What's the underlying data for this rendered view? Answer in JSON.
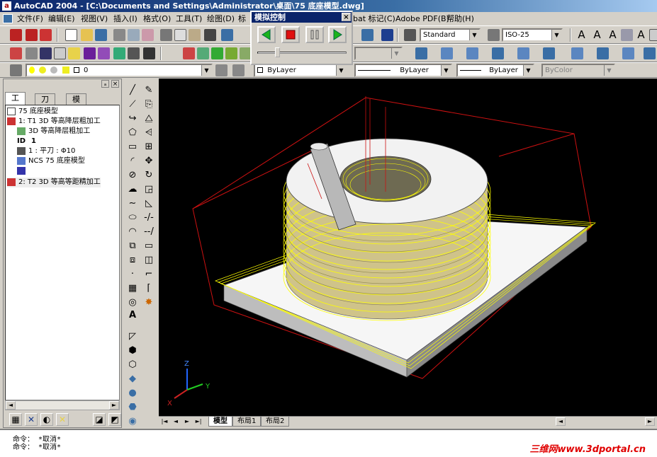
{
  "window": {
    "title": "AutoCAD 2004 - [C:\\Documents and Settings\\Administrator\\桌面\\75 底座模型.dwg]"
  },
  "menu": [
    "文件(F)",
    "编辑(E)",
    "视图(V)",
    "插入(I)",
    "格式(O)",
    "工具(T)",
    "绘图(D)",
    "标",
    "bat 标记(C)",
    "Adobe PDF(B)",
    "帮助(H)"
  ],
  "toolbar": {
    "text_style": "Standard",
    "dim_style": "ISO-25",
    "layer": "0",
    "color": "ByLayer",
    "linetype": "ByLayer",
    "lineweight": "ByLayer",
    "plotstyle": "ByColor"
  },
  "sim_panel": {
    "title": "模拟控制",
    "close": "×",
    "slider_position": 0.2
  },
  "left_panel": {
    "tabs": [
      "工单",
      "刀具",
      "模型"
    ],
    "active_tab": 0,
    "tree": [
      "75 底座模型",
      "1: T1 3D 等高降层粗加工",
      "3D 等高降层粗加工",
      "1",
      "1 :  平刀 : Φ10",
      "NCS 75 底座模型",
      "",
      "2: T2 3D 等高等距精加工"
    ]
  },
  "layout_tabs": [
    "模型",
    "布局1",
    "布局2"
  ],
  "command": {
    "line1": "命令： *取消*",
    "line2": "命令： *取消*"
  },
  "watermark": "三维网www.3dportal.cn",
  "axes": {
    "z": "Z",
    "y": "Y",
    "x": "X"
  },
  "colors": {
    "toolpath": "#ffff00",
    "boundary": "#cc0000",
    "viewport_bg": "#000000",
    "titlebar": "#0a246a"
  }
}
